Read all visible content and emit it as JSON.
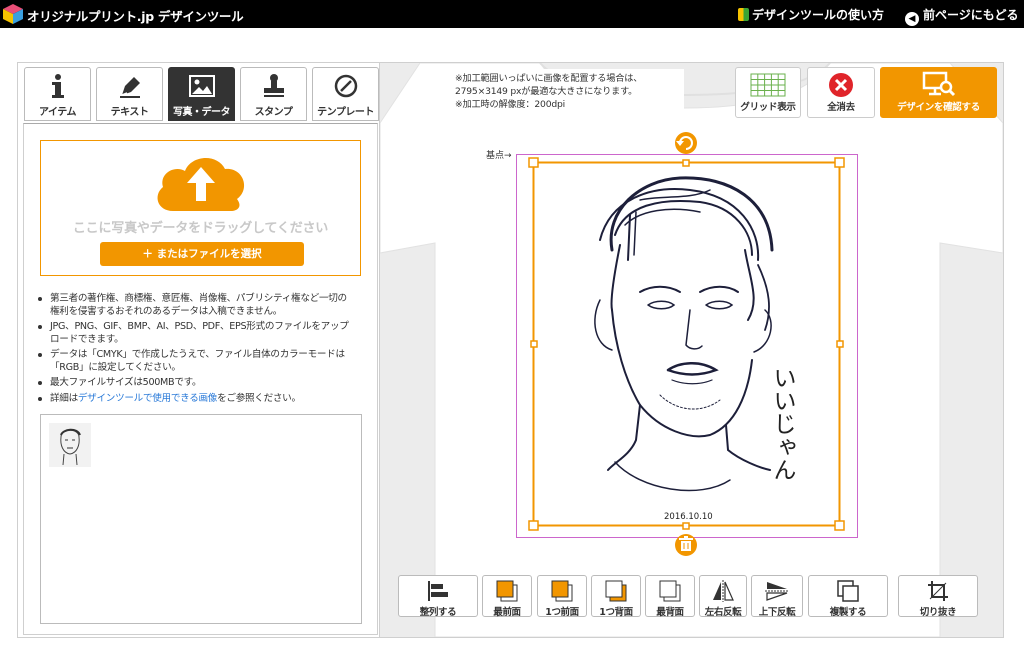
{
  "header": {
    "brand": "オリジナルプリント.jp デザインツール",
    "howto": "デザインツールの使い方",
    "back": "前ページにもどる"
  },
  "tabs": [
    {
      "label": "アイテム",
      "icon": "info-icon"
    },
    {
      "label": "テキスト",
      "icon": "pen-icon"
    },
    {
      "label": "写真・データ",
      "icon": "image-icon",
      "active": true
    },
    {
      "label": "スタンプ",
      "icon": "stamp-icon"
    },
    {
      "label": "テンプレート",
      "icon": "template-icon"
    }
  ],
  "upload": {
    "drop_text": "ここに写真やデータをドラッグしてください",
    "select_button": "＋ またはファイルを選択"
  },
  "notes": [
    "第三者の著作権、商標権、意匠権、肖像権、パブリシティ権など一切の権利を侵害するおそれのあるデータは入稿できません。",
    "JPG、PNG、GIF、BMP、AI、PSD、PDF、EPS形式のファイルをアップロードできます。",
    "データは「CMYK」で作成したうえで、ファイル自体のカラーモードは「RGB」に設定してください。",
    "最大ファイルサイズは500MBです。"
  ],
  "note_link": {
    "prefix": "詳細は",
    "link": "デザインツールで使用できる画像",
    "suffix": "をご参照ください。"
  },
  "info": {
    "line1": "※加工範囲いっぱいに画像を配置する場合は、",
    "line2": "2795×3149 pxが最適な大きさになります。",
    "line3": "※加工時の解像度：200dpi"
  },
  "top_buttons": {
    "grid": "グリッド表示",
    "clear": "全消去",
    "confirm": "デザインを確認する"
  },
  "design": {
    "origin_label": "基点→",
    "vertical_text": "いいじゃん",
    "date": "2016.10.10"
  },
  "toolbar": [
    {
      "label": "整列する",
      "icon": "align-icon"
    },
    {
      "label": "最前面",
      "icon": "bring-front-icon"
    },
    {
      "label": "1つ前面",
      "icon": "bring-forward-icon"
    },
    {
      "label": "1つ背面",
      "icon": "send-backward-icon"
    },
    {
      "label": "最背面",
      "icon": "send-back-icon"
    },
    {
      "label": "左右反転",
      "icon": "flip-horizontal-icon"
    },
    {
      "label": "上下反転",
      "icon": "flip-vertical-icon"
    },
    {
      "label": "複製する",
      "icon": "duplicate-icon"
    },
    {
      "label": "切り抜き",
      "icon": "crop-icon"
    }
  ],
  "colors": {
    "accent": "#f29600",
    "topbar": "#000000",
    "selection": "#cc66cc",
    "link": "#2a7ad8"
  }
}
